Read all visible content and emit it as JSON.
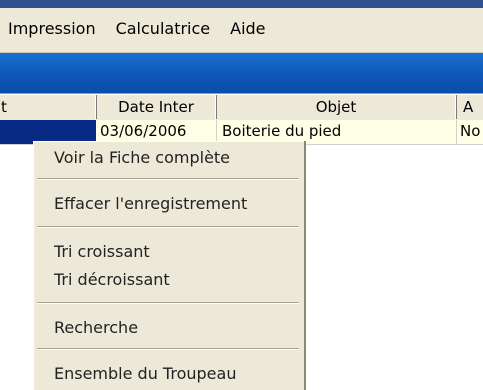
{
  "menu": {
    "items": [
      "Impression",
      "Calculatrice",
      "Aide"
    ]
  },
  "grid": {
    "headers": [
      "t",
      "Date Inter",
      "Objet",
      "A"
    ],
    "row": {
      "date": "03/06/2006",
      "objet": "Boiterie du pied",
      "a": "No"
    }
  },
  "context_menu": {
    "items": [
      "Voir la Fiche complète",
      "Effacer l'enregistrement",
      "Tri croissant",
      "Tri décroissant",
      "Recherche",
      "Ensemble du Troupeau"
    ]
  },
  "colors": {
    "banner": "#0d58b8",
    "selection": "#082a84",
    "row_background": "#ffffe6",
    "menu_background": "#ece9d8"
  }
}
